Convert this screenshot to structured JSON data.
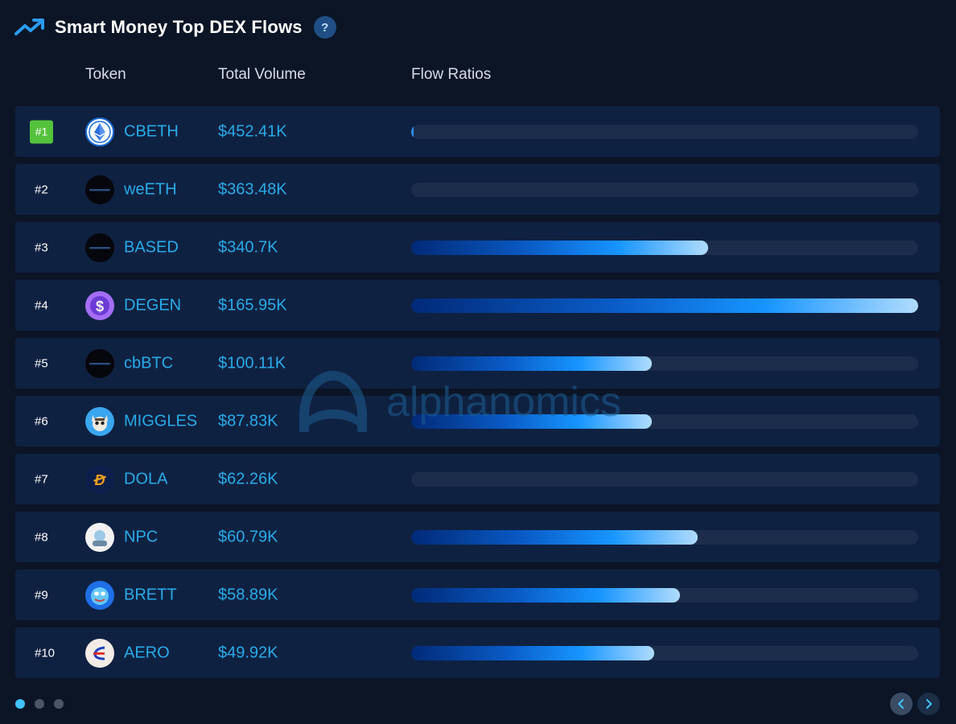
{
  "header": {
    "title": "Smart Money Top DEX Flows",
    "help_label": "?"
  },
  "columns": {
    "token": "Token",
    "volume": "Total Volume",
    "flow": "Flow Ratios"
  },
  "rows": [
    {
      "rank": "#1",
      "token": "CBETH",
      "volume": "$452.41K",
      "flow_ratio": 0.004,
      "icon": "eth-icon"
    },
    {
      "rank": "#2",
      "token": "weETH",
      "volume": "$363.48K",
      "flow_ratio": 0,
      "icon": "dark-coin-icon"
    },
    {
      "rank": "#3",
      "token": "BASED",
      "volume": "$340.7K",
      "flow_ratio": 0.585,
      "icon": "dark-coin-icon"
    },
    {
      "rank": "#4",
      "token": "DEGEN",
      "volume": "$165.95K",
      "flow_ratio": 1.0,
      "icon": "degen-icon"
    },
    {
      "rank": "#5",
      "token": "cbBTC",
      "volume": "$100.11K",
      "flow_ratio": 0.475,
      "icon": "dark-coin-icon"
    },
    {
      "rank": "#6",
      "token": "MIGGLES",
      "volume": "$87.83K",
      "flow_ratio": 0.475,
      "icon": "cat-icon"
    },
    {
      "rank": "#7",
      "token": "DOLA",
      "volume": "$62.26K",
      "flow_ratio": 0,
      "icon": "dola-icon"
    },
    {
      "rank": "#8",
      "token": "NPC",
      "volume": "$60.79K",
      "flow_ratio": 0.565,
      "icon": "npc-icon"
    },
    {
      "rank": "#9",
      "token": "BRETT",
      "volume": "$58.89K",
      "flow_ratio": 0.53,
      "icon": "brett-icon"
    },
    {
      "rank": "#10",
      "token": "AERO",
      "volume": "$49.92K",
      "flow_ratio": 0.48,
      "icon": "aero-icon"
    }
  ],
  "watermark": {
    "text": "alphanomics"
  },
  "pagination": {
    "pages": 3,
    "active": 0
  },
  "colors": {
    "accent": "#29abe8",
    "background": "#0b1526",
    "row": "#0f2141",
    "rank_badge": "#54c23b"
  }
}
